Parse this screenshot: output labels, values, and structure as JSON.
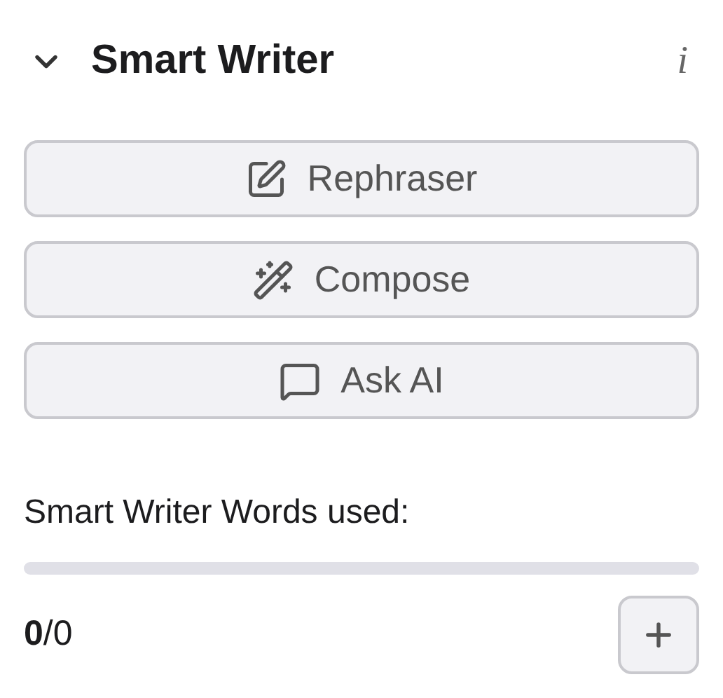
{
  "header": {
    "title": "Smart Writer",
    "expanded": true,
    "info": "i"
  },
  "actions": [
    {
      "kind": "rephrase",
      "label": "Rephraser"
    },
    {
      "kind": "compose",
      "label": "Compose"
    },
    {
      "kind": "ask",
      "label": "Ask AI"
    }
  ],
  "usage": {
    "label": "Smart Writer Words used:",
    "level": 0,
    "count": "**0**/0"
  }
}
